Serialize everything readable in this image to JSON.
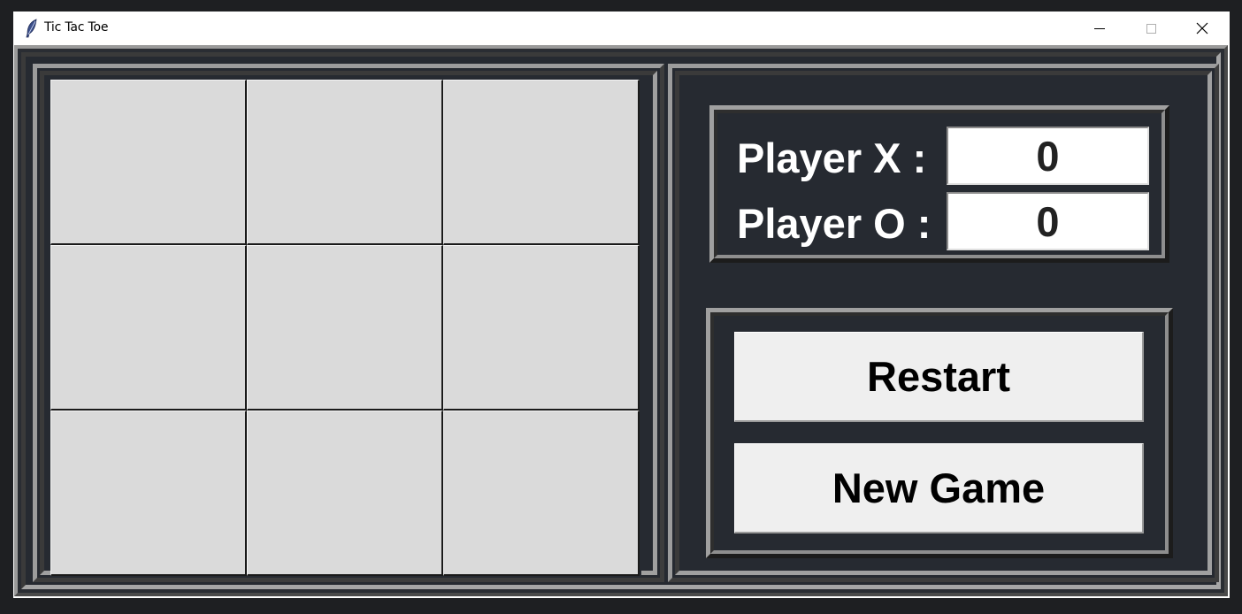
{
  "window": {
    "title": "Tic Tac Toe"
  },
  "board": {
    "cells": [
      "",
      "",
      "",
      "",
      "",
      "",
      "",
      "",
      ""
    ]
  },
  "scores": {
    "player_x_label": "Player X :",
    "player_x_score": "0",
    "player_o_label": "Player O :",
    "player_o_score": "0"
  },
  "controls": {
    "restart_label": "Restart",
    "new_game_label": "New Game"
  },
  "icons": {
    "app": "feather-icon",
    "minimize": "minimize-icon",
    "maximize": "maximize-icon",
    "close": "close-icon"
  },
  "colors": {
    "panel_bg": "#262a31",
    "cell_bg": "#dadada",
    "button_bg": "#efefef",
    "label_text": "#ffffff"
  }
}
